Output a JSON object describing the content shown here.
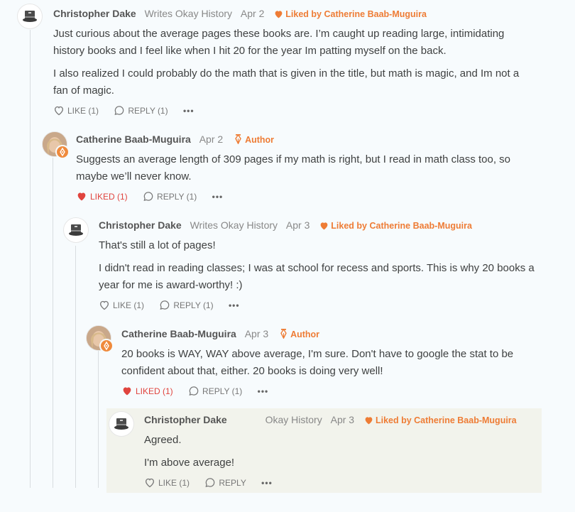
{
  "comments": [
    {
      "name": "Christopher Dake",
      "tagline": "Writes Okay History",
      "date": "Apr 2",
      "liked_by": "Liked by Catherine Baab-Muguira",
      "paragraphs": [
        "Just curious about the average pages these books are. I’m caught up reading large, intimidating history books and I feel like when I hit 20 for the year Im patting myself on the back.",
        "I also realized I could probably do the math that is given in the title, but math is magic, and Im not a fan of magic."
      ],
      "like_label": "LIKE (1)",
      "reply_label": "REPLY (1)",
      "more": "•••"
    },
    {
      "name": "Catherine Baab-Muguira",
      "date": "Apr 2",
      "author_label": "Author",
      "paragraphs": [
        "Suggests an average length of 309 pages if my math is right, but I read in math class too, so maybe we’ll never know."
      ],
      "like_label": "LIKED (1)",
      "reply_label": "REPLY (1)",
      "more": "•••"
    },
    {
      "name": "Christopher Dake",
      "tagline": "Writes Okay History",
      "date": "Apr 3",
      "liked_by": "Liked by Catherine Baab-Muguira",
      "paragraphs": [
        "That's still a lot of pages!",
        "I didn't read in reading classes; I was at school for recess and sports. This is why 20 books a year for me is award-worthy! :)"
      ],
      "like_label": "LIKE (1)",
      "reply_label": "REPLY (1)",
      "more": "•••"
    },
    {
      "name": "Catherine Baab-Muguira",
      "date": "Apr 3",
      "author_label": "Author",
      "paragraphs": [
        "20 books is WAY, WAY above average, I'm sure. Don't have to google the stat to be confident about that, either. 20 books is doing very well!"
      ],
      "like_label": "LIKED (1)",
      "reply_label": "REPLY (1)",
      "more": "•••"
    },
    {
      "name": "Christopher Dake",
      "tagline": "Okay History",
      "date": "Apr 3",
      "liked_by": "Liked by Catherine Baab-Muguira",
      "paragraphs": [
        "Agreed.",
        "I'm above average!"
      ],
      "like_label": "LIKE (1)",
      "reply_label": "REPLY",
      "more": "•••"
    }
  ],
  "colors": {
    "accent": "#ee7c35",
    "liked": "#e0443e",
    "background": "#f7fbfd",
    "highlight": "#f2f3ec"
  }
}
